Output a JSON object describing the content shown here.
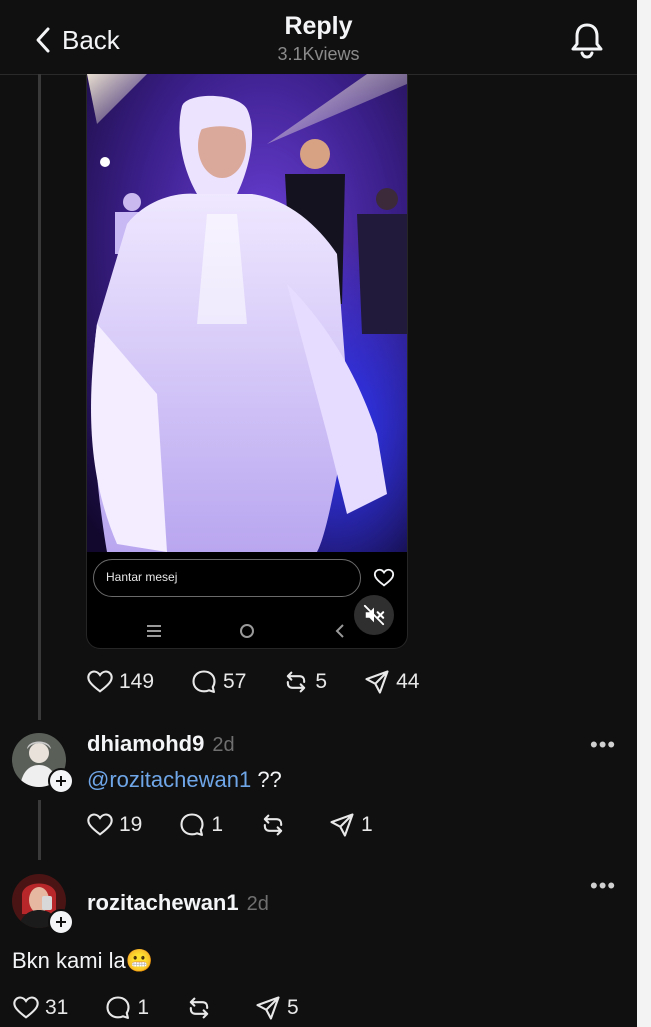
{
  "header": {
    "back_label": "Back",
    "title": "Reply",
    "views": "3.1Kviews"
  },
  "media": {
    "message_placeholder": "Hantar mesej"
  },
  "post": {
    "likes": "149",
    "replies": "57",
    "reposts": "5",
    "shares": "44"
  },
  "comments": [
    {
      "username": "dhiamohd9",
      "time": "2d",
      "mention": "@rozitachewan1",
      "text": " ??",
      "likes": "19",
      "replies": "1",
      "reposts": "",
      "shares": "1"
    },
    {
      "username": "rozitachewan1",
      "time": "2d",
      "text": "Bkn kami la",
      "emoji": "😬",
      "likes": "31",
      "replies": "1",
      "reposts": "",
      "shares": "5"
    }
  ],
  "more_label": "•••",
  "icons": {
    "back": "chevron-left-icon",
    "bell": "bell-icon",
    "like": "heart-icon",
    "reply": "comment-icon",
    "repost": "repost-icon",
    "share": "send-icon"
  },
  "colors": {
    "background": "#101010",
    "mention": "#6fa6e8",
    "muted": "#6f6f6f"
  }
}
